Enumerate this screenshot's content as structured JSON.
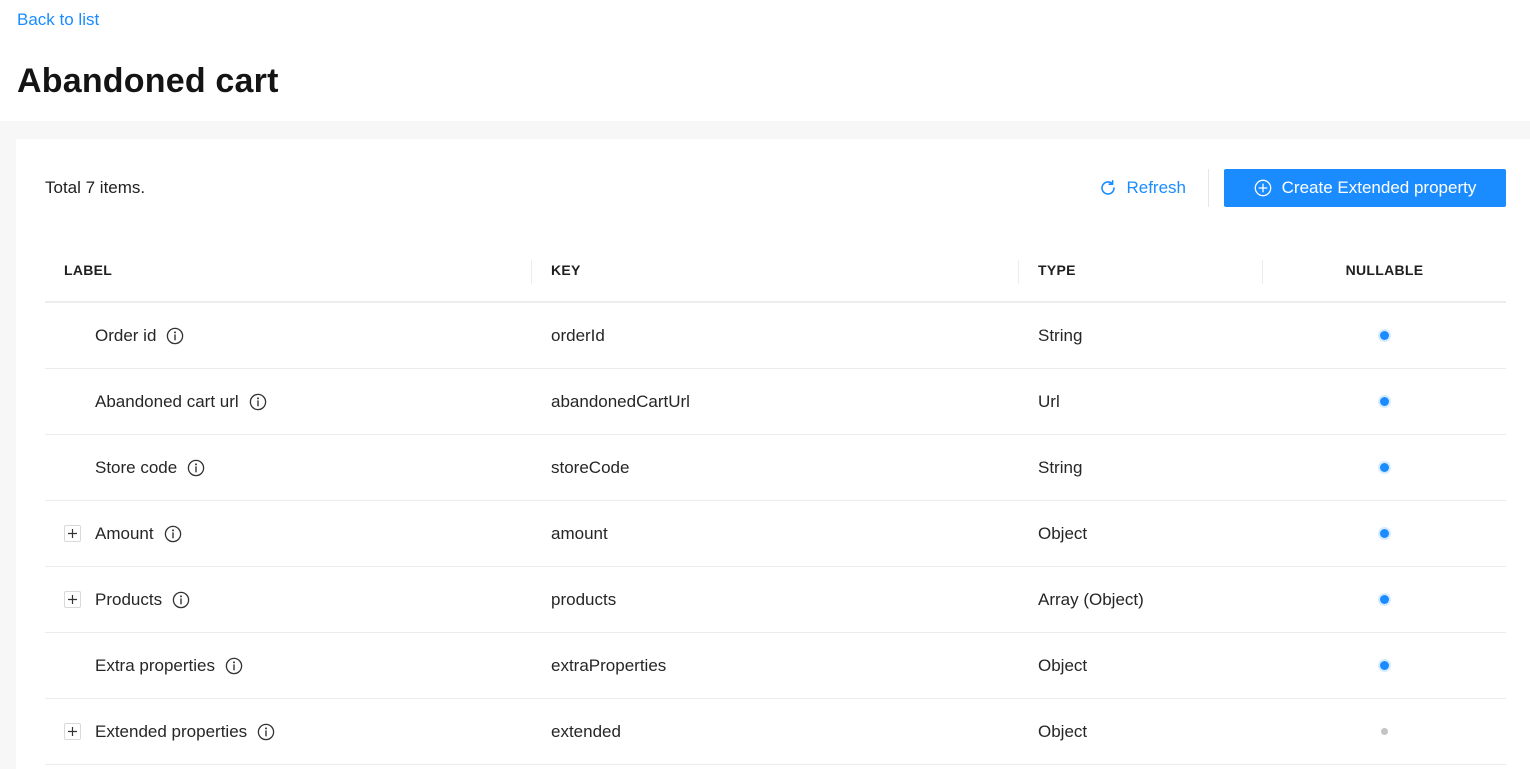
{
  "nav": {
    "back_label": "Back to list"
  },
  "page": {
    "title": "Abandoned cart"
  },
  "toolbar": {
    "total_text": "Total 7 items.",
    "refresh_label": "Refresh",
    "create_label": "Create Extended property"
  },
  "table": {
    "headers": {
      "label": "LABEL",
      "key": "KEY",
      "type": "TYPE",
      "nullable": "NULLABLE"
    },
    "rows": [
      {
        "label": "Order id",
        "key": "orderId",
        "type": "String",
        "expandable": false,
        "nullable": true
      },
      {
        "label": "Abandoned cart url",
        "key": "abandonedCartUrl",
        "type": "Url",
        "expandable": false,
        "nullable": true
      },
      {
        "label": "Store code",
        "key": "storeCode",
        "type": "String",
        "expandable": false,
        "nullable": true
      },
      {
        "label": "Amount",
        "key": "amount",
        "type": "Object",
        "expandable": true,
        "nullable": true
      },
      {
        "label": "Products",
        "key": "products",
        "type": "Array (Object)",
        "expandable": true,
        "nullable": true
      },
      {
        "label": "Extra properties",
        "key": "extraProperties",
        "type": "Object",
        "expandable": false,
        "nullable": true
      },
      {
        "label": "Extended properties",
        "key": "extended",
        "type": "Object",
        "expandable": true,
        "nullable": false
      }
    ]
  },
  "colors": {
    "accent": "#1a8cff",
    "nullable_false": "#c4c4c4"
  }
}
